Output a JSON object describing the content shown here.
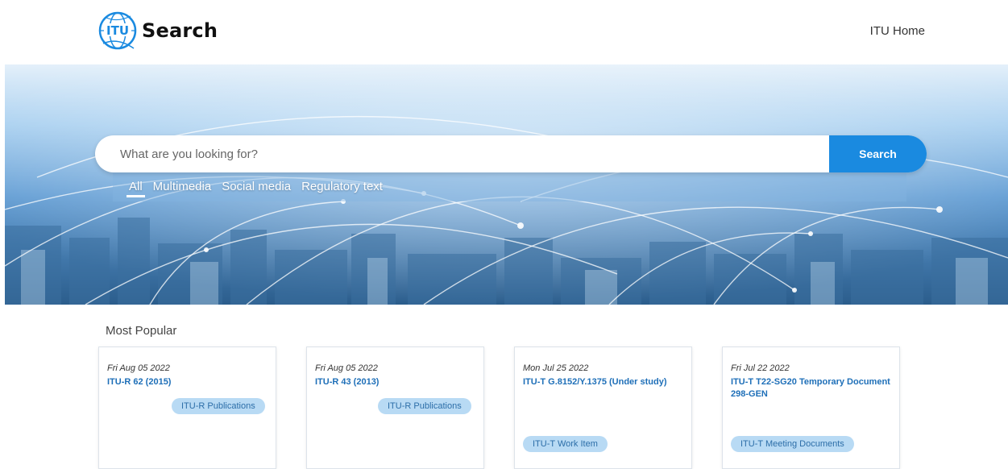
{
  "header": {
    "logo_text": "Search",
    "home_link": "ITU Home"
  },
  "search": {
    "placeholder": "What are you looking for?",
    "button_label": "Search",
    "tabs": [
      {
        "label": "All",
        "active": true
      },
      {
        "label": "Multimedia",
        "active": false
      },
      {
        "label": "Social media",
        "active": false
      },
      {
        "label": "Regulatory text",
        "active": false
      }
    ]
  },
  "most_popular": {
    "title": "Most Popular",
    "cards": [
      {
        "date": "Fri Aug 05 2022",
        "title": "ITU-R 62 (2015)",
        "tag": "ITU-R Publications"
      },
      {
        "date": "Fri Aug 05 2022",
        "title": "ITU-R 43 (2013)",
        "tag": "ITU-R Publications"
      },
      {
        "date": "Mon Jul 25 2022",
        "title": "ITU-T G.8152/Y.1375 (Under study)",
        "tag": "ITU-T Work Item"
      },
      {
        "date": "Fri Jul 22 2022",
        "title": "ITU-T T22-SG20 Temporary Document 298-GEN",
        "tag": "ITU-T Meeting Documents"
      }
    ]
  },
  "colors": {
    "accent": "#1a8ae0",
    "link": "#1e6fb8",
    "tag_bg": "#b8daf4"
  }
}
